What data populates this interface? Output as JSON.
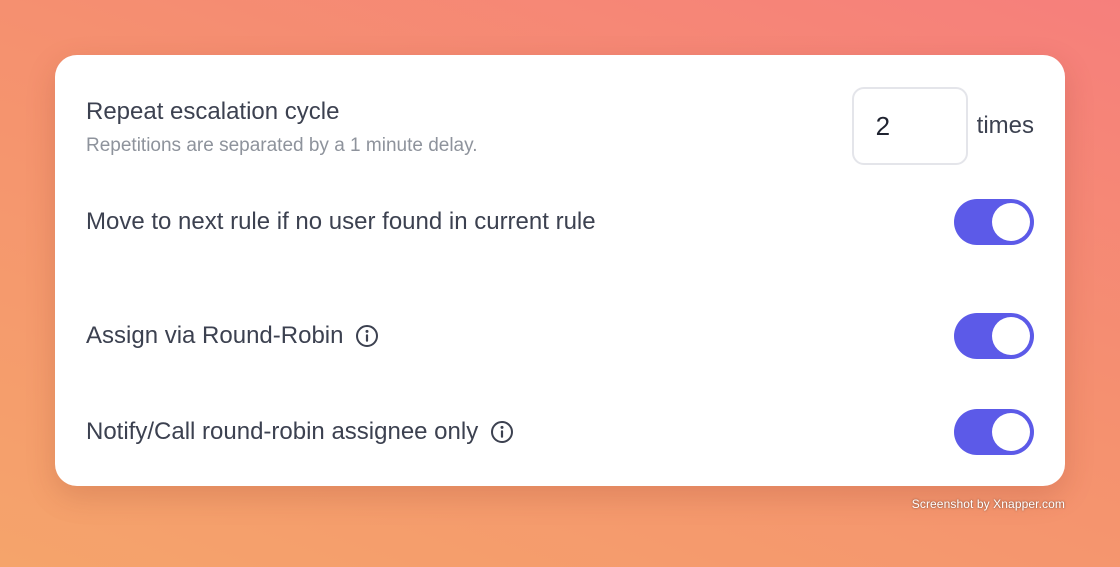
{
  "repeat": {
    "title": "Repeat escalation cycle",
    "subtitle": "Repetitions are separated by a 1 minute delay.",
    "value": "2",
    "unit": "times"
  },
  "toggles": [
    {
      "label": "Move to next rule if no user found in current rule",
      "on": true,
      "icon": ""
    },
    {
      "label": "Assign via Round-Robin",
      "on": true,
      "icon": "info-icon"
    },
    {
      "label": "Notify/Call round-robin assignee only",
      "on": true,
      "icon": "info-icon"
    }
  ],
  "colors": {
    "accent": "#5c5ae8",
    "text": "#3c4150",
    "muted": "#8e939c"
  },
  "watermark": "Screenshot by Xnapper.com"
}
